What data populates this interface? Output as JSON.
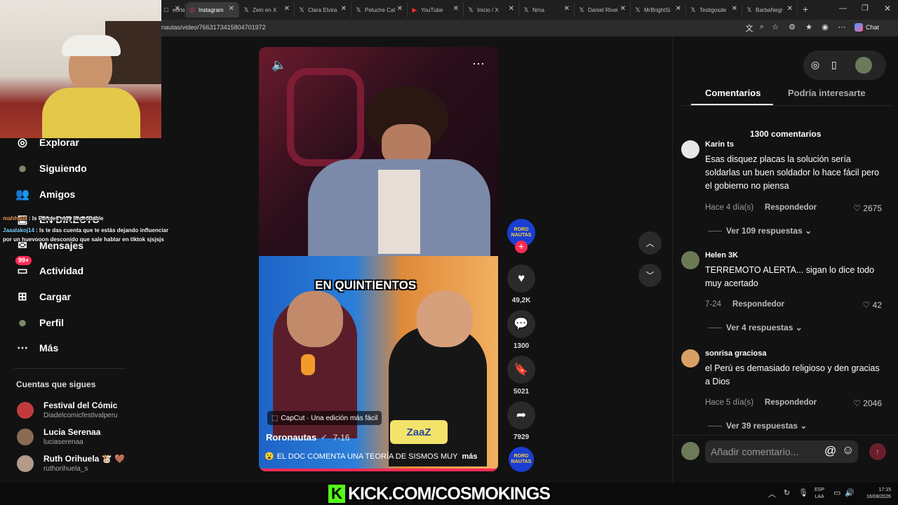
{
  "browser": {
    "tabs": [
      {
        "label": "eorla",
        "icon": "page-icon"
      },
      {
        "label": "Instagram",
        "icon": "instagram-icon",
        "active": true
      },
      {
        "label": "Zein en X",
        "icon": "x-icon"
      },
      {
        "label": "Clara Elvira",
        "icon": "x-icon"
      },
      {
        "label": "Peluche Cal",
        "icon": "x-icon"
      },
      {
        "label": "YouTube",
        "icon": "youtube-icon"
      },
      {
        "label": "Inicio / X",
        "icon": "x-icon"
      },
      {
        "label": "Nma",
        "icon": "x-icon"
      },
      {
        "label": "Daniel Rivei",
        "icon": "x-icon"
      },
      {
        "label": "MrBrightSi",
        "icon": "x-icon"
      },
      {
        "label": "Testigosde",
        "icon": "x-icon"
      },
      {
        "label": "BarbaNegr",
        "icon": "x-icon"
      }
    ],
    "url": "nautas/video/7663173415804701972",
    "chat_button": "Chat"
  },
  "nav": {
    "items": [
      {
        "label": "Explorar",
        "icon": "compass-icon"
      },
      {
        "label": "Siguiendo",
        "icon": "following-avatar-icon"
      },
      {
        "label": "Amigos",
        "icon": "friends-icon"
      },
      {
        "label": "EN DIRECTO",
        "icon": "live-icon"
      },
      {
        "label": "Mensajes",
        "icon": "message-icon"
      },
      {
        "label": "Actividad",
        "icon": "inbox-icon",
        "badge": "99+"
      },
      {
        "label": "Cargar",
        "icon": "plus-square-icon"
      },
      {
        "label": "Perfil",
        "icon": "profile-avatar-icon"
      },
      {
        "label": "Más",
        "icon": "more-dots-icon"
      }
    ],
    "following_title": "Cuentas que sigues",
    "following": [
      {
        "name": "Festival del Cómic",
        "handle": "Diadelcomicfestivalperu",
        "color": "#c23b3b"
      },
      {
        "name": "Lucia Serenaa",
        "handle": "luciaserenaa",
        "color": "#8a6a52"
      },
      {
        "name": "Ruth Orihuela 🐮 🤎",
        "handle": "ruthorihuela_s",
        "color": "#b39a8a"
      }
    ]
  },
  "chat_overlay": [
    {
      "user": "mahha03",
      "text": "Is Pero es muy improbable"
    },
    {
      "user": "Jaaalakoj14",
      "text": "Is te das cuenta que te estás dejando influenciar por un huevooon desconido que sale hablar en tiktok sjsjsjs"
    }
  ],
  "video": {
    "caption_overlay": "EN QUINTIENTOS",
    "capcut": "CapCut · Una edición más fácil",
    "author": "Roronautas",
    "date": "7-16",
    "description": "EL DOC COMENTA UNA TEORÍA DE SISMOS MUY",
    "more": "más",
    "sponsor": "ZaaZ"
  },
  "actions": {
    "avatar_label": "RORO NAUTAS",
    "likes": "49,2K",
    "comments": "1300",
    "saves": "5021",
    "shares": "7929"
  },
  "comments_panel": {
    "tab_comments": "Comentarios",
    "tab_interest": "Podría interesarte",
    "count": "1300 comentarios",
    "items": [
      {
        "user": "Karin ts",
        "text": "Esas disquez placas la solución sería soldarlas un buen soldador lo hace fácil pero el gobierno no piensa",
        "time": "Hace 4 día(s)",
        "reply": "Respondedor",
        "likes": "2675",
        "more": "Ver 109 respuestas",
        "color": "#e8e8e8"
      },
      {
        "user": "Helen 3K",
        "text": "TERREMOTO ALERTA... sigan lo dice todo muy acertado",
        "time": "7-24",
        "reply": "Respondedor",
        "likes": "42",
        "more": "Ver 4 respuestas",
        "color": "#6b7a55"
      },
      {
        "user": "sonrisa graciosa",
        "text": "el Perú es demasiado religioso y den gracias a Dios",
        "time": "Hace 5 día(s)",
        "reply": "Respondedor",
        "likes": "2046",
        "more": "Ver 39 respuestas",
        "color": "#d9a066"
      }
    ],
    "input_placeholder": "Añadir comentario..."
  },
  "taskbar": {
    "kick_text": "KICK.COM/COSMOKINGS",
    "lang_top": "ESP",
    "lang_bottom": "LAA",
    "time": "17:15",
    "date": "16/08/2026"
  }
}
